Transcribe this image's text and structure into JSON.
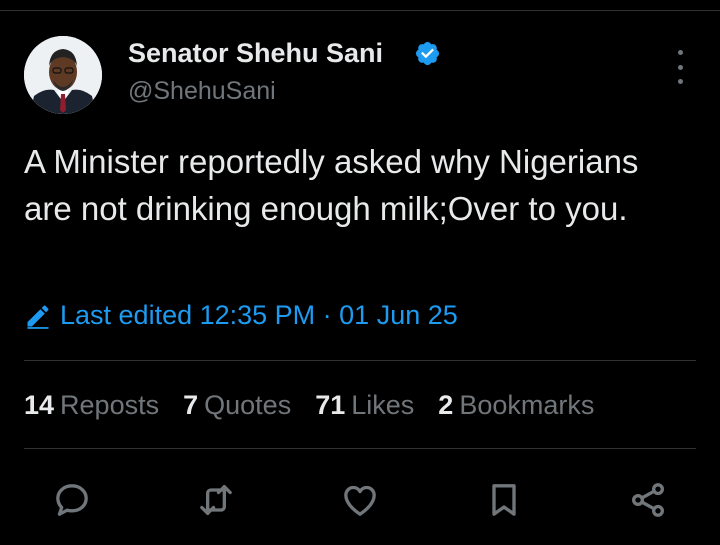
{
  "author": {
    "display_name": "Senator Shehu Sani",
    "handle": "@ShehuSani",
    "verified": true,
    "avatar": "profile-photo"
  },
  "tweet": {
    "text": "A Minister reportedly asked why Nigerians are not drinking enough milk;Over to you.",
    "edited_label": "Last edited 12:35 PM · 01 Jun 25"
  },
  "stats": [
    {
      "count": "14",
      "label": "Reposts"
    },
    {
      "count": "7",
      "label": "Quotes"
    },
    {
      "count": "71",
      "label": "Likes"
    },
    {
      "count": "2",
      "label": "Bookmarks"
    }
  ],
  "actions": [
    "reply-icon",
    "repost-icon",
    "like-icon",
    "bookmark-icon",
    "share-icon"
  ],
  "colors": {
    "background": "#000000",
    "text": "#e7e9ea",
    "muted": "#71767b",
    "accent": "#1d9bf0",
    "divider": "#2f3336"
  }
}
